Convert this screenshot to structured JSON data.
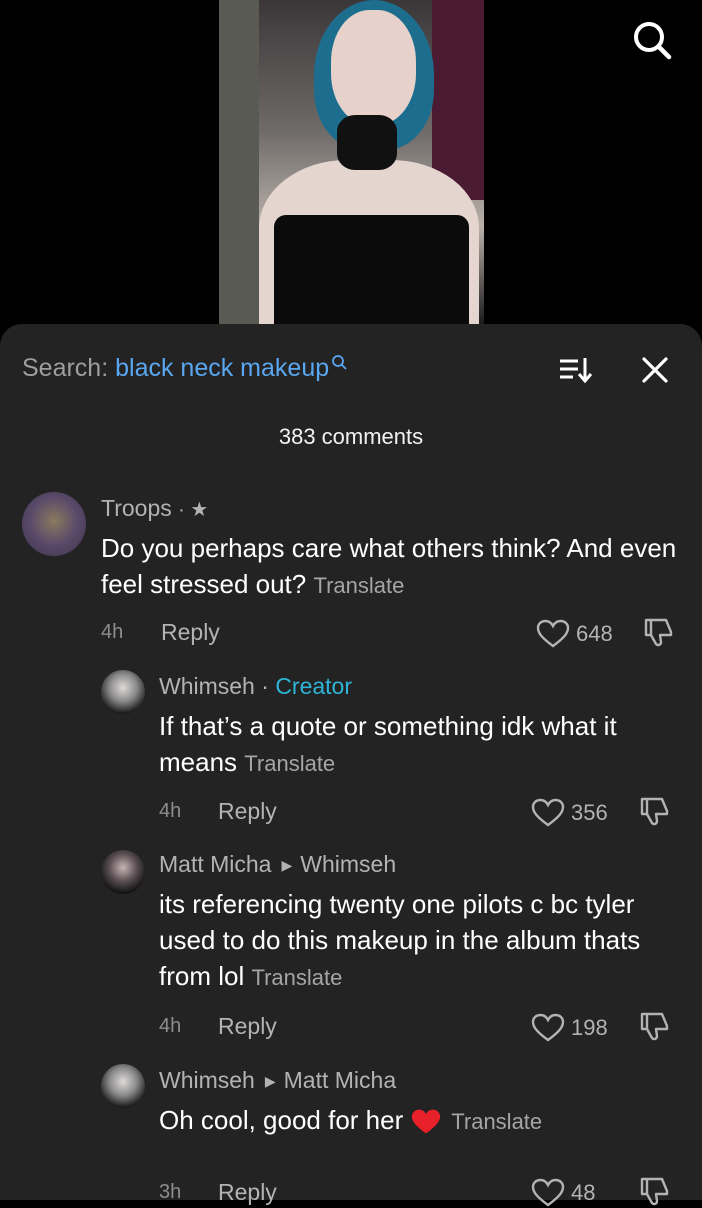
{
  "header": {
    "search_prefix": "Search:",
    "search_query": "black neck makeup",
    "comment_count": "383 comments"
  },
  "comments": [
    {
      "user": "Troops",
      "badge": "· ★",
      "text": "Do you perhaps care what others think? And even feel stressed out?",
      "translate": "Translate",
      "time": "4h",
      "reply": "Reply",
      "likes": "648"
    },
    {
      "user": "Whimseh",
      "separator": "·",
      "tag": "Creator",
      "text": "If that’s a quote or something idk what it means",
      "translate": "Translate",
      "time": "4h",
      "reply": "Reply",
      "likes": "356"
    },
    {
      "user": "Matt Micha",
      "reply_to": "Whimseh",
      "text": "its referencing twenty one pilots c bc tyler used to do this makeup in the album thats from lol",
      "translate": "Translate",
      "time": "4h",
      "reply": "Reply",
      "likes": "198"
    },
    {
      "user": "Whimseh",
      "reply_to": "Matt Micha",
      "text": "Oh cool, good for her",
      "translate": "Translate",
      "time": "3h",
      "reply": "Reply",
      "likes": "48"
    }
  ],
  "colors": {
    "sheet_bg": "#232323",
    "link_blue": "#5aa6f0",
    "creator_cyan": "#2fb4d8"
  },
  "icons": [
    "search-icon",
    "sort-icon",
    "close-icon",
    "heart-icon",
    "dislike-icon",
    "caret-right-icon",
    "red-heart-emoji"
  ]
}
